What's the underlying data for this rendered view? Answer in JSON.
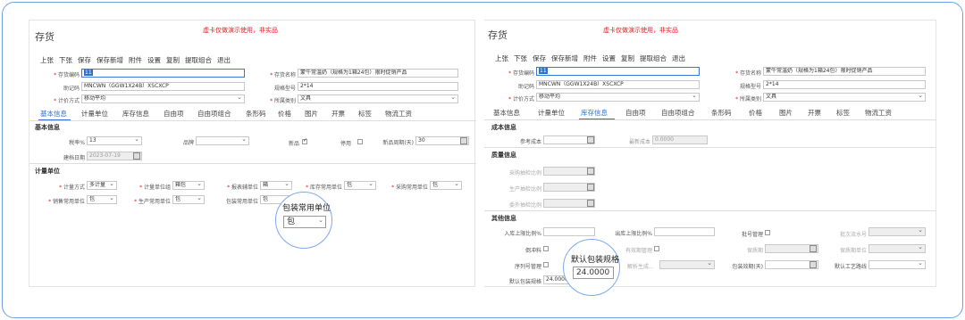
{
  "left": {
    "warning": "虚卡仅做演示使用，非实品",
    "title": "存货",
    "toolbar": [
      "上张",
      "下张",
      "保存",
      "保存新增",
      "附件",
      "设置",
      "复制",
      "提取组合",
      "退出"
    ],
    "fields": {
      "code_label": "存货编码",
      "code_value": "11",
      "helper_label": "助记码",
      "helper_value": "MNCWN（GGW1X24B）XSCXCP",
      "cost_label": "计价方式",
      "cost_value": "移动平均",
      "name_label": "存货名称",
      "name_value": "蒙牛常温奶（规格为1箱24包）限时促销产品",
      "spec_label": "规格型号",
      "spec_value": "2*14",
      "cat_label": "所属类别",
      "cat_value": "文具"
    },
    "tabs": [
      "基本信息",
      "计量单位",
      "库存信息",
      "自由项",
      "自由项组合",
      "条形码",
      "价格",
      "图片",
      "开票",
      "标签",
      "物流工资"
    ],
    "basic": {
      "section": "基本信息",
      "tax_label": "税率%",
      "tax_value": "13",
      "brand_label": "品牌",
      "new_label": "新品",
      "stop_label": "停用",
      "newperiod_label": "新品周期(天)",
      "newperiod_value": "30",
      "date_label": "建档日期",
      "date_value": "2023-07-19"
    },
    "unit": {
      "section": "计量单位",
      "mode_label": "计量方式",
      "mode_value": "多计量",
      "unitgroup_label": "计量单位组",
      "unitgroup_value": "箱包",
      "report_label": "报表辅单位",
      "report_value": "箱",
      "stock_label": "库存常用单位",
      "stock_value": "包",
      "purchase_label": "采购常用单位",
      "purchase_value": "包",
      "sale_label": "销售常用单位",
      "sale_value": "包",
      "prod_label": "生产常用单位",
      "prod_value": "包",
      "pack_label": "包装常用单位",
      "pack_value": "包"
    },
    "callout": {
      "label": "包装常用单位",
      "value": "包"
    }
  },
  "right": {
    "warning": "虚卡仅做演示使用，非实品",
    "title": "存货",
    "toolbar": [
      "上张",
      "下张",
      "保存",
      "保存新增",
      "附件",
      "设置",
      "复制",
      "提取组合",
      "退出"
    ],
    "fields": {
      "code_label": "存货编码",
      "code_value": "11",
      "helper_label": "助记码",
      "helper_value": "MNCWN（GGW1X24B）XSCXCP",
      "cost_label": "计价方式",
      "cost_value": "移动平均",
      "name_label": "存货名称",
      "name_value": "蒙牛常温奶（规格为1箱24包）限时促销产品",
      "spec_label": "规格型号",
      "spec_value": "2*14",
      "cat_label": "所属类别",
      "cat_value": "文具"
    },
    "tabs": [
      "基本信息",
      "计量单位",
      "库存信息",
      "自由项",
      "自由项组合",
      "条形码",
      "价格",
      "图片",
      "开票",
      "标签",
      "物流工资"
    ],
    "cost": {
      "section": "成本信息",
      "ref_label": "参考成本",
      "latest_label": "最新成本",
      "latest_value": "0.0000"
    },
    "quality": {
      "section": "质量信息",
      "purchase_label": "采购抽检比例",
      "prod_label": "生产抽检比例",
      "outsource_label": "委外抽检比例"
    },
    "other": {
      "section": "其他信息",
      "inlimit_label": "入库上限比例%",
      "outlimit_label": "出库上限比例%",
      "batch_label": "批号管理",
      "batchserial_label": "批次流水号",
      "pallet_label": "倒冲料",
      "expiry_label": "有效期管理",
      "shelf_label": "保质期",
      "shelfunit_label": "保质期单位",
      "serial_label": "序列号管理",
      "parse_label": "解析生成...",
      "packdays_label": "包装效期(天)",
      "route_label": "默认工艺路线",
      "defpack_label": "默认包装规格",
      "defpack_value": "24.0000"
    },
    "callout": {
      "label": "默认包装规格",
      "value": "24.0000"
    }
  }
}
